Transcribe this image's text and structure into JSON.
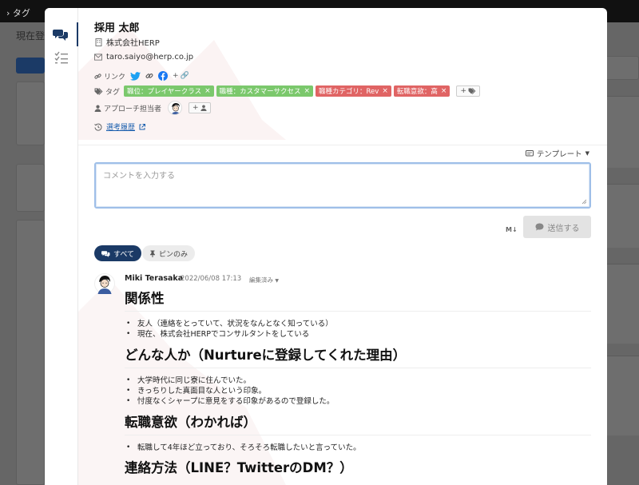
{
  "background": {
    "topbar_label": "タグ",
    "page_title": "現在登"
  },
  "profile": {
    "name": "採用 太郎",
    "company": "株式会社HERP",
    "email": "taro.saiyo@herp.co.jp",
    "links_label": "リンク",
    "add_link_label": "+",
    "tags_label": "タグ",
    "tags": [
      {
        "text": "職位：プレイヤークラス",
        "color": "#7bc86c"
      },
      {
        "text": "職種：カスタマーサクセス",
        "color": "#7bc86c"
      },
      {
        "text": "職種カテゴリ：Rev",
        "color": "#e06464"
      },
      {
        "text": "転職意欲：高",
        "color": "#e06464"
      }
    ],
    "add_tag_label": "+",
    "approach_label": "アプローチ担当者",
    "add_member_label": "+",
    "history_link": "選考履歴"
  },
  "composer": {
    "template_label": "テンプレート",
    "placeholder": "コメントを入力する",
    "markdown_label": "M↓",
    "send_label": "送信する"
  },
  "filters": {
    "all_label": "すべて",
    "pinned_label": "ピンのみ"
  },
  "comment": {
    "author": "Miki Terasaka",
    "date": "2022/06/08 17:13",
    "edited": "編集済み",
    "sections": [
      {
        "heading": "関係性",
        "items": [
          "友人（連絡をとっていて、状況をなんとなく知っている）",
          "現在、株式会社HERPでコンサルタントをしている"
        ]
      },
      {
        "heading": "どんな人か（Nurtureに登録してくれた理由）",
        "items": [
          "大学時代に同じ寮に住んでいた。",
          "きっちりした真面目な人という印象。",
          "忖度なくシャープに意見をする印象があるので登録した。"
        ]
      },
      {
        "heading": "転職意欲（わかれば）",
        "items": [
          "転職して4年ほど立っており、そろそろ転職したいと言っていた。"
        ]
      },
      {
        "heading": "連絡方法（LINE？TwitterのDM？）",
        "items": []
      }
    ]
  },
  "colors": {
    "navy": "#1b3a66",
    "tag_green": "#7bc86c",
    "tag_red": "#e06464",
    "twitter": "#1da1f2",
    "facebook": "#1877f2",
    "link_blue": "#1b5fae"
  }
}
